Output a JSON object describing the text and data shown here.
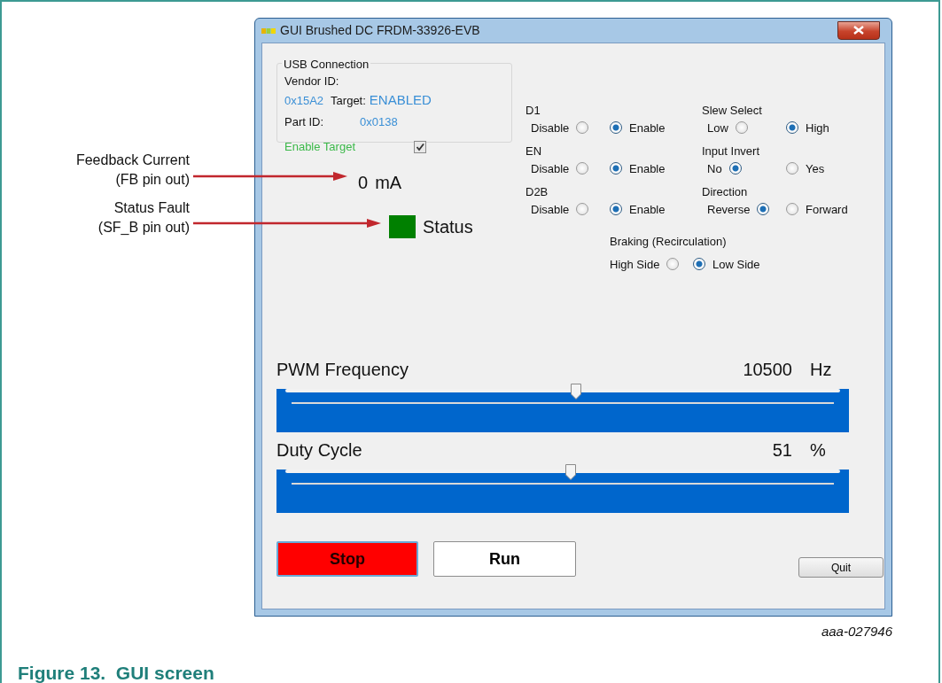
{
  "figure": {
    "annotations": [
      {
        "label": "Feedback Current",
        "note": "(FB pin out)"
      },
      {
        "label": "Status Fault",
        "note": "(SF_B pin out)"
      }
    ],
    "code": "aaa-027946",
    "caption": "Figure 13.  GUI screen"
  },
  "window": {
    "title": "GUI Brushed DC FRDM-33926-EVB"
  },
  "usb": {
    "title": "USB Connection",
    "vendor_label": "Vendor ID:",
    "vendor_value": "0x15A2",
    "target_label": "Target:",
    "target_value": "ENABLED",
    "part_label": "Part ID:",
    "part_value": "0x0138",
    "enable_target": {
      "label": "Enable Target",
      "checked": true
    }
  },
  "current": {
    "value": "0",
    "unit": "mA"
  },
  "status": {
    "label": "Status",
    "color": "#008000"
  },
  "radio_groups": [
    {
      "title": "D1",
      "options": [
        {
          "label": "Disable",
          "selected": false
        },
        {
          "label": "Enable",
          "selected": true
        }
      ]
    },
    {
      "title": "Slew Select",
      "options": [
        {
          "label": "Low",
          "selected": false
        },
        {
          "label": "High",
          "selected": true
        }
      ]
    },
    {
      "title": "EN",
      "options": [
        {
          "label": "Disable",
          "selected": false
        },
        {
          "label": "Enable",
          "selected": true
        }
      ]
    },
    {
      "title": "Input Invert",
      "options": [
        {
          "label": "No",
          "selected": true
        },
        {
          "label": "Yes",
          "selected": false
        }
      ]
    },
    {
      "title": "D2B",
      "options": [
        {
          "label": "Disable",
          "selected": false
        },
        {
          "label": "Enable",
          "selected": true
        }
      ]
    },
    {
      "title": "Direction",
      "options": [
        {
          "label": "Reverse",
          "selected": true
        },
        {
          "label": "Forward",
          "selected": false
        }
      ]
    },
    {
      "title": "Braking (Recirculation)",
      "options": [
        {
          "label": "High Side",
          "selected": false
        },
        {
          "label": "Low Side",
          "selected": true
        }
      ]
    }
  ],
  "sliders": [
    {
      "label": "PWM Frequency",
      "value": "10500",
      "unit": "Hz",
      "level": 0.524
    },
    {
      "label": "Duty Cycle",
      "value": "51",
      "unit": "%",
      "level": 0.514
    }
  ],
  "buttons": [
    {
      "label": "Stop",
      "kind": "stop"
    },
    {
      "label": "Run",
      "kind": "run"
    },
    {
      "label": "Quit",
      "kind": "quit"
    }
  ]
}
